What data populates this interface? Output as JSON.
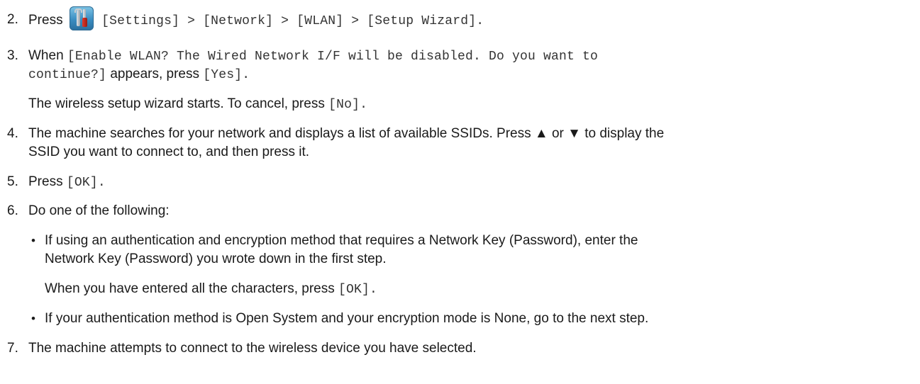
{
  "steps": [
    {
      "number": "2.",
      "press": "Press",
      "icon": "settings-tools-icon",
      "path": "[Settings] > [Network] > [WLAN] > [Setup Wizard]."
    },
    {
      "number": "3.",
      "when": "When",
      "message_line1": "[Enable WLAN? The Wired Network I/F will be disabled. Do you want to",
      "message_line2": "continue?]",
      "appears_press": "appears, press",
      "yes": "[Yes].",
      "note": "The wireless setup wizard starts. To cancel, press",
      "no": "[No]."
    },
    {
      "number": "4.",
      "line1": "The machine searches for your network and displays a list of available SSIDs. Press ▲ or ▼ to display the",
      "line2": "SSID you want to connect to, and then press it."
    },
    {
      "number": "5.",
      "press": "Press",
      "ok": "[OK]."
    },
    {
      "number": "6.",
      "text": "Do one of the following:",
      "bullets": [
        {
          "symbol": "•",
          "line1": "If using an authentication and encryption method that requires a Network Key (Password), enter the",
          "line2": "Network Key (Password) you wrote down in the first step.",
          "note": "When you have entered all the characters, press",
          "ok": "[OK]."
        },
        {
          "symbol": "•",
          "line1": "If your authentication method is Open System and your encryption mode is None, go to the next step."
        }
      ]
    },
    {
      "number": "7.",
      "text": "The machine attempts to connect to the wireless device you have selected."
    }
  ]
}
